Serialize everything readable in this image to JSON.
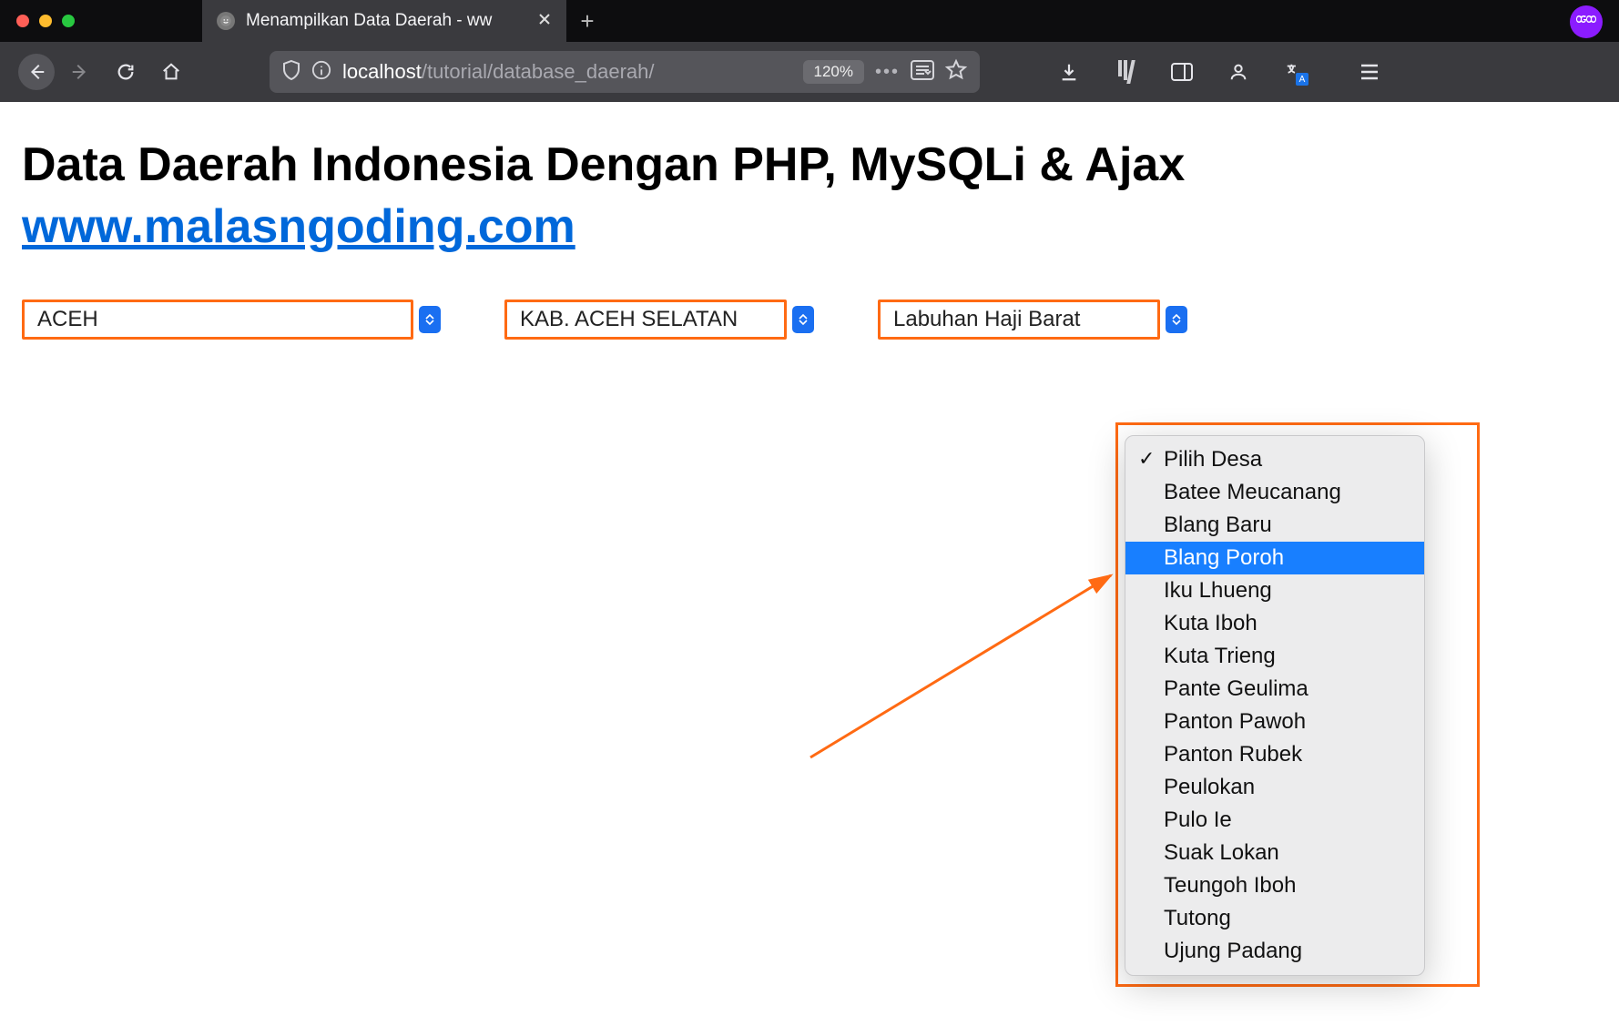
{
  "browser": {
    "tab_title": "Menampilkan Data Daerah - ww",
    "url_host": "localhost",
    "url_path": "/tutorial/database_daerah/",
    "zoom": "120%"
  },
  "page": {
    "heading": "Data Daerah Indonesia Dengan PHP, MySQLi & Ajax",
    "site_link_text": "www.malasngoding.com"
  },
  "selects": {
    "provinsi": "ACEH",
    "kabupaten": "KAB. ACEH SELATAN",
    "kecamatan": "Labuhan Haji Barat",
    "desa_placeholder": "Pilih Desa",
    "desa_highlighted": "Blang Poroh",
    "desa_options": [
      "Pilih Desa",
      "Batee Meucanang",
      "Blang Baru",
      "Blang Poroh",
      "Iku Lhueng",
      "Kuta Iboh",
      "Kuta Trieng",
      "Pante Geulima",
      "Panton Pawoh",
      "Panton Rubek",
      "Peulokan",
      "Pulo Ie",
      "Suak Lokan",
      "Teungoh Iboh",
      "Tutong",
      "Ujung Padang"
    ]
  }
}
